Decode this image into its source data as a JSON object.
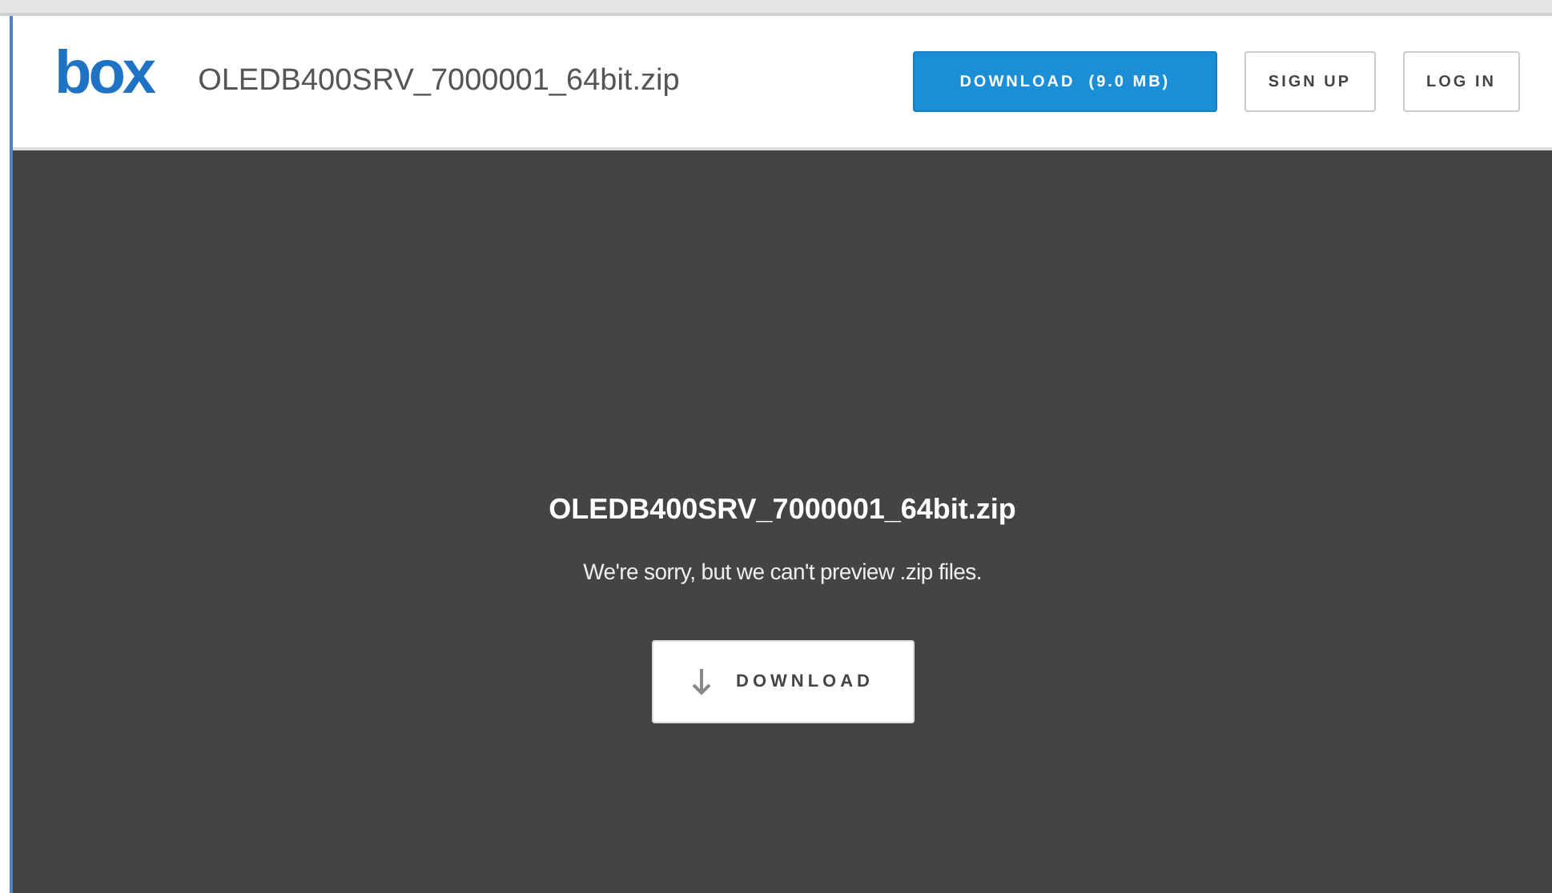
{
  "header": {
    "logo": "box",
    "file_name": "OLEDB400SRV_7000001_64bit.zip",
    "buttons": [
      {
        "label": "DOWNLOAD  (9.0 MB)",
        "kind": "primary"
      },
      {
        "label": "SIGN UP",
        "kind": "secondary"
      },
      {
        "label": "LOG IN",
        "kind": "secondary"
      }
    ]
  },
  "preview": {
    "title": "OLEDB400SRV_7000001_64bit.zip",
    "message": "We're sorry, but we can't preview .zip files.",
    "button": "DOWNLOAD"
  }
}
